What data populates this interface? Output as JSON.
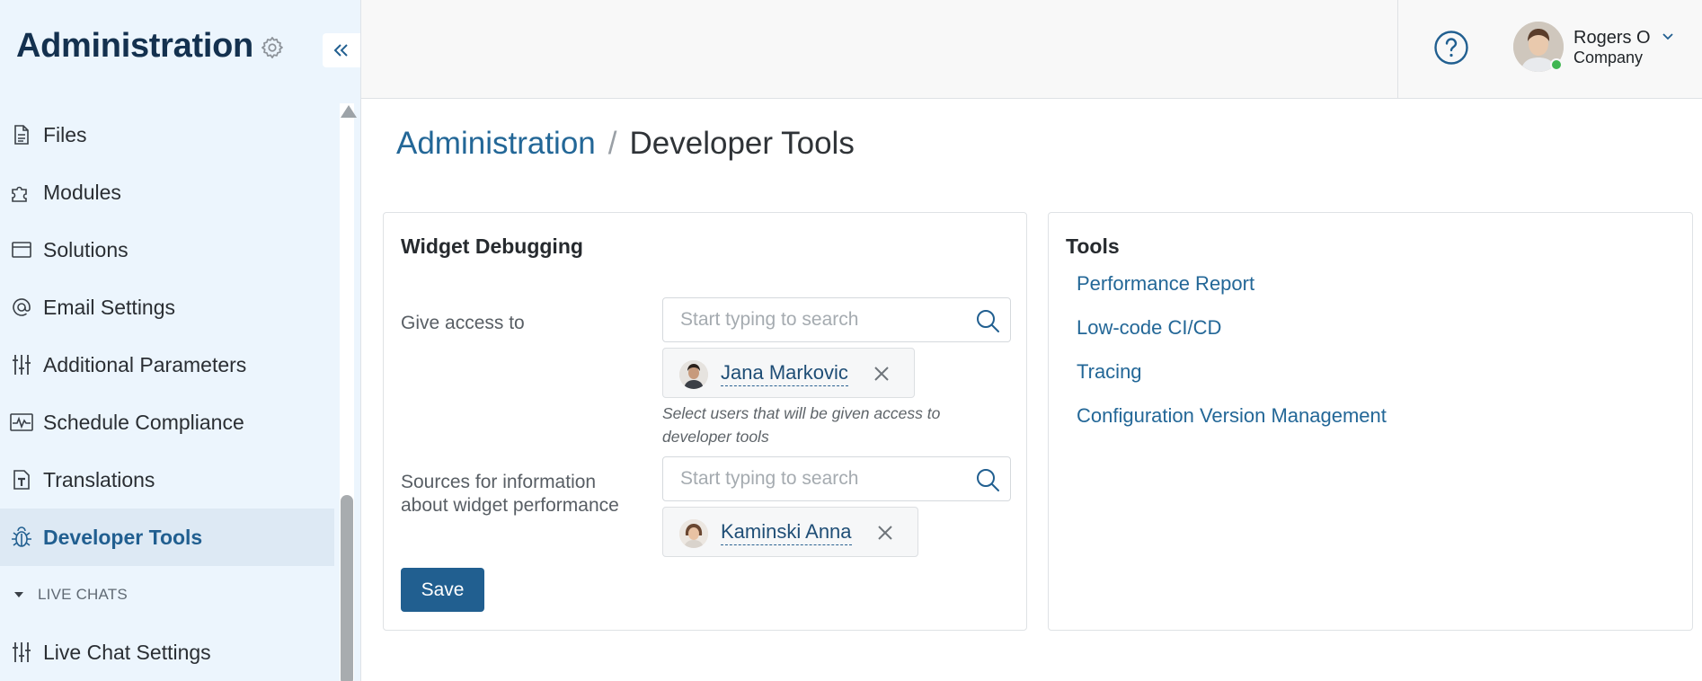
{
  "sidebar": {
    "title": "Administration",
    "items": [
      {
        "label": "Files",
        "icon": "file-icon"
      },
      {
        "label": "Modules",
        "icon": "puzzle-icon"
      },
      {
        "label": "Solutions",
        "icon": "window-icon"
      },
      {
        "label": "Email Settings",
        "icon": "at-sign-icon"
      },
      {
        "label": "Additional Parameters",
        "icon": "sliders-icon"
      },
      {
        "label": "Schedule Compliance",
        "icon": "pulse-icon"
      },
      {
        "label": "Translations",
        "icon": "translate-doc-icon"
      },
      {
        "label": "Developer Tools",
        "icon": "bug-icon",
        "active": true
      }
    ],
    "section": {
      "label": "LIVE CHATS"
    },
    "section_items": [
      {
        "label": "Live Chat Settings",
        "icon": "sliders-icon"
      }
    ]
  },
  "header": {
    "user_name": "Rogers O",
    "user_company": "Company",
    "online_color": "#3fb650"
  },
  "breadcrumb": {
    "parent": "Administration",
    "separator": "/",
    "current": "Developer Tools"
  },
  "widget_debugging": {
    "title": "Widget Debugging",
    "access": {
      "label": "Give access to",
      "placeholder": "Start typing to search",
      "selected": "Jana Markovic",
      "hint": "Select users that will be given access to developer tools"
    },
    "sources": {
      "label": "Sources for information about widget performance",
      "placeholder": "Start typing to search",
      "selected": "Kaminski Anna"
    },
    "save_label": "Save"
  },
  "tools": {
    "title": "Tools",
    "links": [
      "Performance Report",
      "Low-code CI/CD",
      "Tracing",
      "Configuration Version Management"
    ]
  },
  "colors": {
    "accent": "#215f90",
    "link": "#236797",
    "sidebar_bg": "#ecf5fd",
    "active_bg": "#dde9f4"
  }
}
